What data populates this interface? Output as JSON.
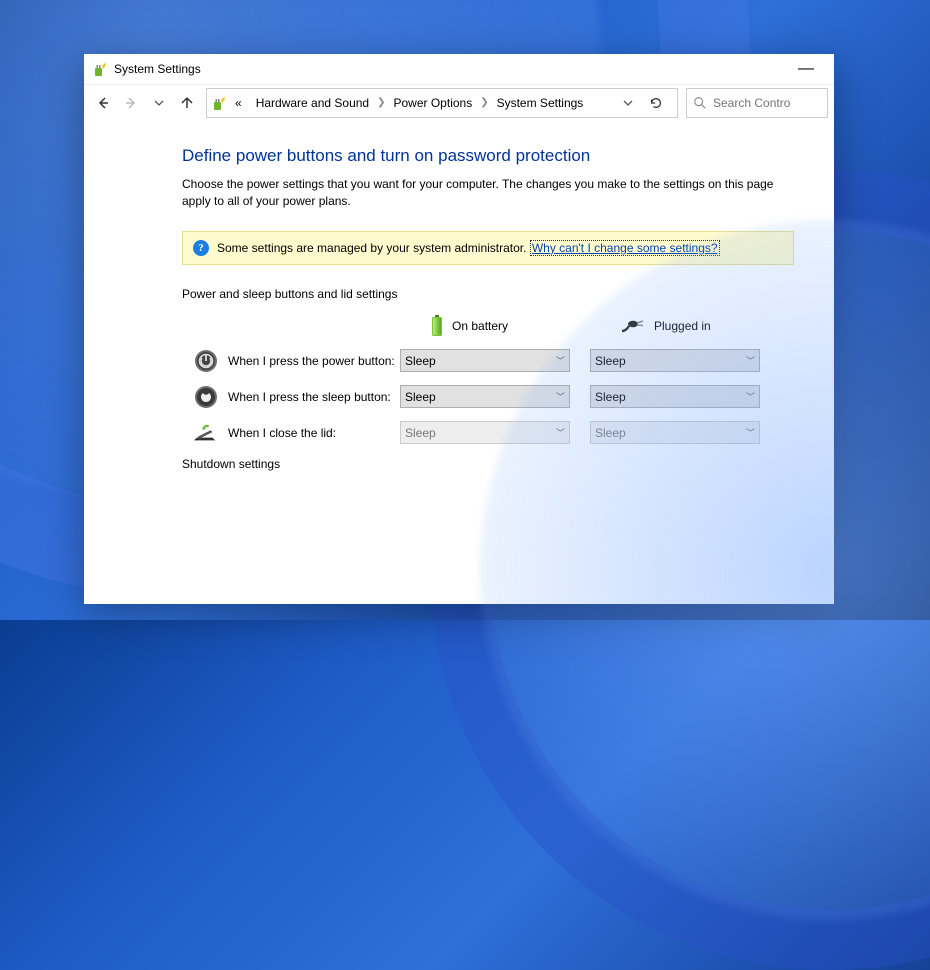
{
  "titlebar": {
    "title": "System Settings"
  },
  "breadcrumbs": {
    "prefix": "«",
    "items": [
      "Hardware and Sound",
      "Power Options",
      "System Settings"
    ]
  },
  "search": {
    "placeholder": "Search Contro"
  },
  "heading": "Define power buttons and turn on password protection",
  "description": "Choose the power settings that you want for your computer. The changes you make to the settings on this page apply to all of your power plans.",
  "notice": {
    "text": "Some settings are managed by your system administrator.",
    "link": "Why can't I change some settings?"
  },
  "section": {
    "title": "Power and sleep buttons and lid settings",
    "cols": {
      "battery": "On battery",
      "plugged": "Plugged in"
    },
    "rows": [
      {
        "label": "When I press the power button:",
        "battery": "Sleep",
        "plugged": "Sleep",
        "enabled": true
      },
      {
        "label": "When I press the sleep button:",
        "battery": "Sleep",
        "plugged": "Sleep",
        "enabled": true
      },
      {
        "label": "When I close the lid:",
        "battery": "Sleep",
        "plugged": "Sleep",
        "enabled": false
      }
    ]
  },
  "shutdown_section": "Shutdown settings"
}
